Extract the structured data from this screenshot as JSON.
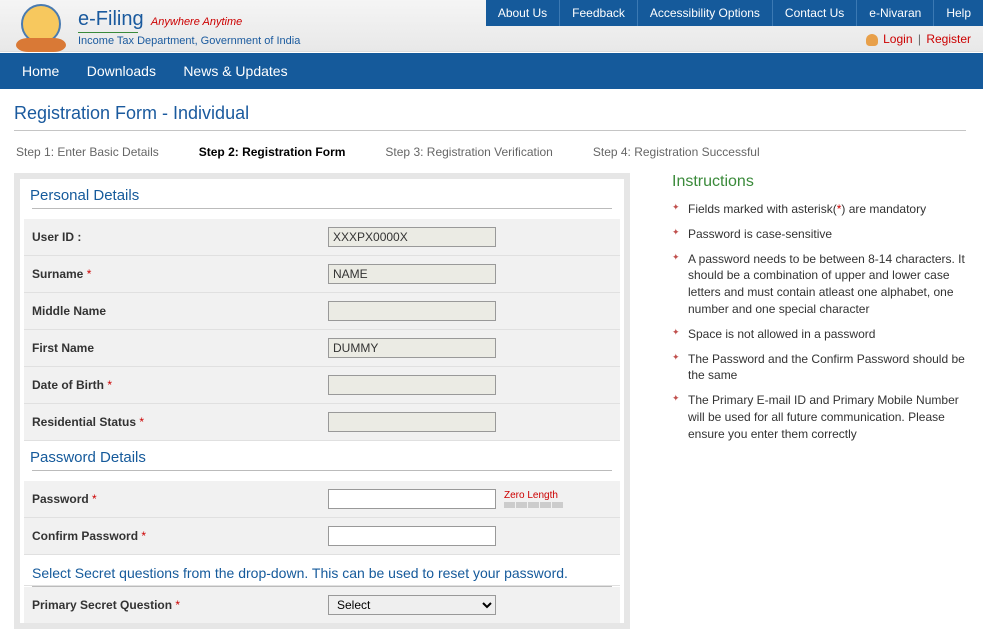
{
  "brand": {
    "main": "e-Filing",
    "tagline": "Anywhere Anytime",
    "sub": "Income Tax Department, Government of India"
  },
  "topnav": {
    "about": "About Us",
    "feedback": "Feedback",
    "accessibility": "Accessibility Options",
    "contact": "Contact Us",
    "enivaran": "e-Nivaran",
    "help": "Help"
  },
  "login": {
    "login": "Login",
    "register": "Register"
  },
  "mainnav": {
    "home": "Home",
    "downloads": "Downloads",
    "news": "News & Updates"
  },
  "page_title": "Registration Form - Individual",
  "steps": {
    "s1": "Step 1: Enter Basic Details",
    "s2": "Step 2: Registration Form",
    "s3": "Step 3: Registration Verification",
    "s4": "Step 4: Registration Successful"
  },
  "sections": {
    "personal": "Personal Details",
    "password": "Password Details",
    "secret_note": "Select Secret questions from the drop-down. This can be used to reset your password."
  },
  "fields": {
    "user_id": {
      "label": "User ID :",
      "value": "XXXPX0000X"
    },
    "surname": {
      "label": "Surname",
      "value": "NAME"
    },
    "middle": {
      "label": "Middle Name",
      "value": ""
    },
    "first": {
      "label": "First Name",
      "value": "DUMMY"
    },
    "dob": {
      "label": "Date of Birth",
      "value": ""
    },
    "res": {
      "label": "Residential Status",
      "value": ""
    },
    "password": {
      "label": "Password",
      "value": ""
    },
    "confirm": {
      "label": "Confirm Password",
      "value": ""
    },
    "secret_q": {
      "label": "Primary Secret Question",
      "selected": "Select"
    }
  },
  "strength": {
    "label": "Zero Length"
  },
  "instructions": {
    "title": "Instructions",
    "items": [
      "Fields marked with asterisk(*) are mandatory",
      "Password is case-sensitive",
      "A password needs to be between 8-14 characters. It should be a combination of upper and lower case letters and must contain atleast one alphabet, one number and one special character",
      "Space is not allowed in a password",
      "The Password and the Confirm Password should be the same",
      "The Primary E-mail ID and Primary Mobile Number will be used for all future communication. Please ensure you enter them correctly"
    ]
  }
}
